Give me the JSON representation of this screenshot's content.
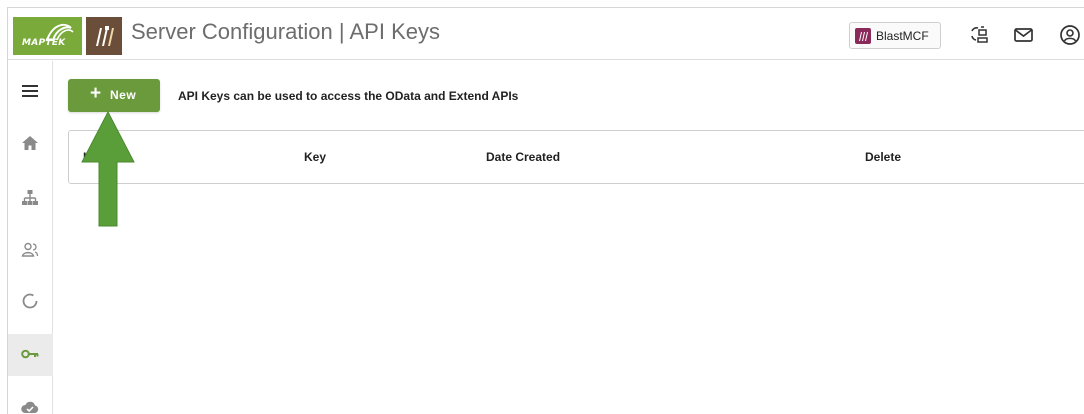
{
  "brand": {
    "company_logo_text": "MAPTEK",
    "colors": {
      "brand_green": "#7aab3a",
      "button_green": "#6a9a3c",
      "app_logo_brown": "#6b4e3a",
      "arrow_green": "#5a9e3a"
    }
  },
  "header": {
    "title": "Server Configuration | API Keys",
    "site_chip_label": "BlastMCF",
    "icons": [
      "sync-status-icon",
      "mail-icon",
      "user-account-icon"
    ]
  },
  "sidebar": {
    "items": [
      {
        "icon": "menu-icon",
        "active": false
      },
      {
        "icon": "home-icon",
        "active": false
      },
      {
        "icon": "hierarchy-icon",
        "active": false
      },
      {
        "icon": "users-icon",
        "active": false
      },
      {
        "icon": "circle-progress-icon",
        "active": false
      },
      {
        "icon": "key-icon",
        "active": true
      },
      {
        "icon": "cloud-check-icon",
        "active": false
      }
    ]
  },
  "main": {
    "new_button": {
      "icon": "+",
      "label": "New"
    },
    "hint_text": "API Keys can be used to access the OData and Extend APIs",
    "table": {
      "columns": [
        "L",
        "Key",
        "Date Created",
        "Delete"
      ],
      "rows": []
    }
  }
}
